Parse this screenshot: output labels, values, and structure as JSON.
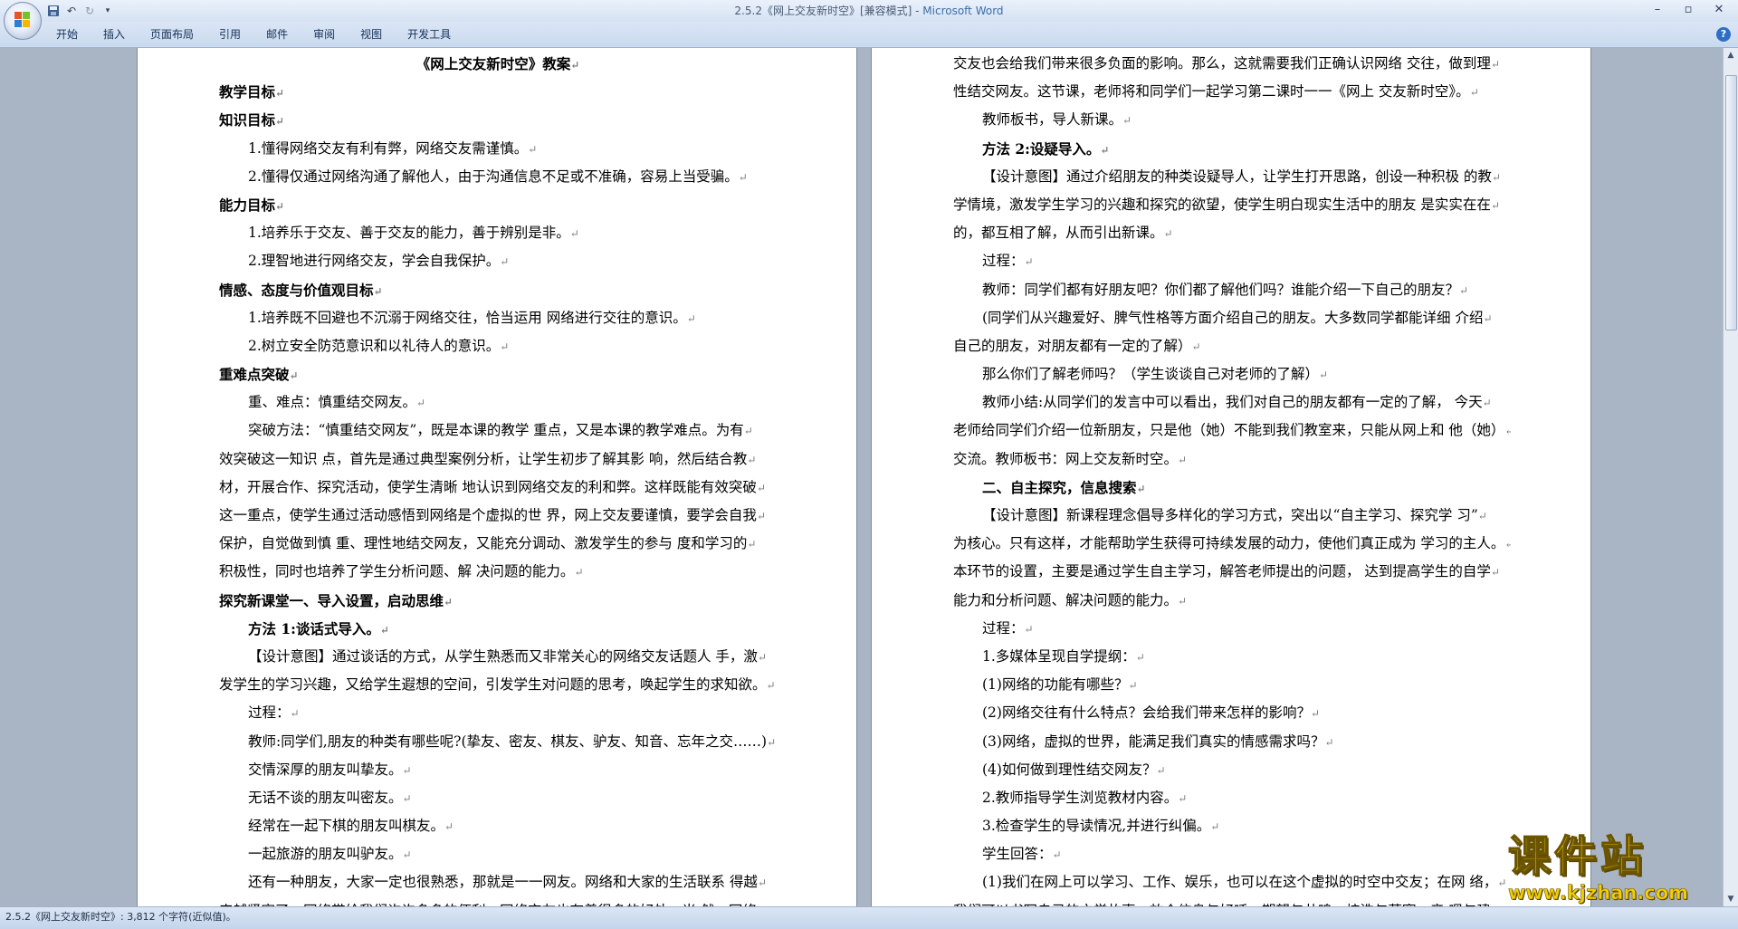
{
  "window": {
    "title": "2.5.2《网上交友新时空》[兼容模式] - ",
    "app_name": "Microsoft Word"
  },
  "ribbon": {
    "tabs": [
      "开始",
      "插入",
      "页面布局",
      "引用",
      "邮件",
      "审阅",
      "视图",
      "开发工具"
    ]
  },
  "page1": {
    "lines": [
      {
        "text": "《网上交友新时空》教案",
        "style": "center"
      },
      {
        "text": "教学目标",
        "style": "bold"
      },
      {
        "text": "知识目标",
        "style": "bold"
      },
      {
        "text": "1.懂得网络交友有利有弊，网络交友需谨慎。",
        "style": "ind1"
      },
      {
        "text": "2.懂得仅通过网络沟通了解他人，由于沟通信息不足或不准确，容易上当受骗。",
        "style": "ind1"
      },
      {
        "text": "能力目标",
        "style": "bold"
      },
      {
        "text": "1.培养乐于交友、善于交友的能力，善于辨别是非。",
        "style": "ind1"
      },
      {
        "text": "2.理智地进行网络交友，学会自我保护。",
        "style": "ind1"
      },
      {
        "text": "情感、态度与价值观目标",
        "style": "bold"
      },
      {
        "text": "1.培养既不回避也不沉溺于网络交往，恰当运用 网络进行交往的意识。",
        "style": "ind1"
      },
      {
        "text": "2.树立安全防范意识和以礼待人的意识。",
        "style": "ind1"
      },
      {
        "text": "重难点突破",
        "style": "bold"
      },
      {
        "text": "重、难点：慎重结交网友。",
        "style": "ind1"
      },
      {
        "text": "突破方法：“慎重结交网友”，既是本课的教学 重点，又是本课的教学难点。为有",
        "style": "ind1"
      },
      {
        "text": "效突破这一知识 点，首先是通过典型案例分析，让学生初步了解其影 响，然后结合教",
        "style": ""
      },
      {
        "text": "材，开展合作、探究活动，使学生清晰 地认识到网络交友的利和弊。这样既能有效突破",
        "style": ""
      },
      {
        "text": "这一重点，使学生通过活动感悟到网络是个虚拟的世 界，网上交友要谨慎，要学会自我",
        "style": ""
      },
      {
        "text": "保护，自觉做到慎 重、理性地结交网友，又能充分调动、激发学生的参与 度和学习的",
        "style": ""
      },
      {
        "text": "积极性，同时也培养了学生分析问题、解 决问题的能力。",
        "style": ""
      },
      {
        "text": "探究新课堂一、导入设置，启动思维",
        "style": "bold"
      },
      {
        "text": "方法 1:谈话式导入。",
        "style": "ind1 bold"
      },
      {
        "text": "【设计意图】通过谈话的方式，从学生熟悉而又非常关心的网络交友话题人 手，激",
        "style": "ind1"
      },
      {
        "text": "发学生的学习兴趣，又给学生遐想的空间，引发学生对问题的思考，唤起学生的求知欲。",
        "style": ""
      },
      {
        "text": "过程：",
        "style": "ind1"
      },
      {
        "text": "教师:同学们,朋友的种类有哪些呢?(挚友、密友、棋友、驴友、知音、忘年之交……)",
        "style": "ind1"
      },
      {
        "text": "交情深厚的朋友叫挚友。",
        "style": "ind1"
      },
      {
        "text": "无话不谈的朋友叫密友。",
        "style": "ind1"
      },
      {
        "text": "经常在一起下棋的朋友叫棋友。",
        "style": "ind1"
      },
      {
        "text": "一起旅游的朋友叫驴友。",
        "style": "ind1"
      },
      {
        "text": "还有一种朋友，大家一定也很熟悉，那就是一一网友。网络和大家的生活联系 得越",
        "style": "ind1"
      },
      {
        "text": "来越紧密了，网络带给我们许许多多的便利。网络交友也有着很多的好处，当 然，网络",
        "style": ""
      }
    ]
  },
  "page2": {
    "lines": [
      {
        "text": "交友也会给我们带来很多负面的影响。那么，这就需要我们正确认识网络 交往，做到理",
        "style": ""
      },
      {
        "text": "性结交网友。这节课，老师将和同学们一起学习第二课时一一《网上 交友新时空》。",
        "style": ""
      },
      {
        "text": "教师板书，导人新课。",
        "style": "ind1"
      },
      {
        "text": "方法 2:设疑导入。",
        "style": "ind1 bold"
      },
      {
        "text": "【设计意图】通过介绍朋友的种类设疑导人，让学生打开思路，创设一种积极 的教",
        "style": "ind1"
      },
      {
        "text": "学情境，激发学生学习的兴趣和探究的欲望，使学生明白现实生活中的朋友 是实实在在",
        "style": ""
      },
      {
        "text": "的，都互相了解，从而引出新课。",
        "style": ""
      },
      {
        "text": "过程：",
        "style": "ind1"
      },
      {
        "text": "教师：同学们都有好朋友吧？你们都了解他们吗？谁能介绍一下自己的朋友？",
        "style": "ind1"
      },
      {
        "text": "(同学们从兴趣爱好、脾气性格等方面介绍自己的朋友。大多数同学都能详细 介绍",
        "style": "ind1"
      },
      {
        "text": "自己的朋友，对朋友都有一定的了解）",
        "style": ""
      },
      {
        "text": "那么你们了解老师吗？（学生谈谈自己对老师的了解）",
        "style": "ind1"
      },
      {
        "text": "教师小结:从同学们的发言中可以看出，我们对自己的朋友都有一定的了解， 今天",
        "style": "ind1"
      },
      {
        "text": "老师给同学们介绍一位新朋友，只是他（她）不能到我们教室来，只能从网上和 他（她）",
        "style": ""
      },
      {
        "text": "交流。教师板书：网上交友新时空。",
        "style": ""
      },
      {
        "text": "二、自主探究，信息搜索",
        "style": "ind1 bold"
      },
      {
        "text": "【设计意图】新课程理念倡导多样化的学习方式，突出以“自主学习、探究学 习”",
        "style": "ind1"
      },
      {
        "text": "为核心。只有这样，才能帮助学生获得可持续发展的动力，使他们真正成为 学习的主人。",
        "style": ""
      },
      {
        "text": "本环节的设置，主要是通过学生自主学习，解答老师提出的问题， 达到提高学生的自学",
        "style": ""
      },
      {
        "text": "能力和分析问题、解决问题的能力。",
        "style": ""
      },
      {
        "text": "过程：",
        "style": "ind1"
      },
      {
        "text": "1.多媒体呈现自学提纲：",
        "style": "ind1"
      },
      {
        "text": "(1)网络的功能有哪些？",
        "style": "ind1"
      },
      {
        "text": "(2)网络交往有什么特点？会给我们带来怎样的影响？",
        "style": "ind1"
      },
      {
        "text": "(3)网络，虚拟的世界，能满足我们真实的情感需求吗？",
        "style": "ind1"
      },
      {
        "text": "(4)如何做到理性结交网友？",
        "style": "ind1"
      },
      {
        "text": "2.教师指导学生浏览教材内容。",
        "style": "ind1"
      },
      {
        "text": "3.检查学生的导读情况,并进行纠偏。",
        "style": "ind1"
      },
      {
        "text": "学生回答：",
        "style": "ind1"
      },
      {
        "text": "(1)我们在网上可以学习、工作、娱乐，也可以在这个虚拟的时空中交友；在网 络，",
        "style": "ind1"
      },
      {
        "text": "我们可以书写自己的文学故事，放个信息与好呼，期望与共鸣，梳洗与落寞，音 嗯与建",
        "style": ""
      }
    ]
  },
  "status": {
    "text": "2.5.2《网上交友新时空》: 3,812 个字符(近似值)。"
  },
  "watermark": {
    "title": "课件站",
    "url": "www.kjzhan.com"
  }
}
